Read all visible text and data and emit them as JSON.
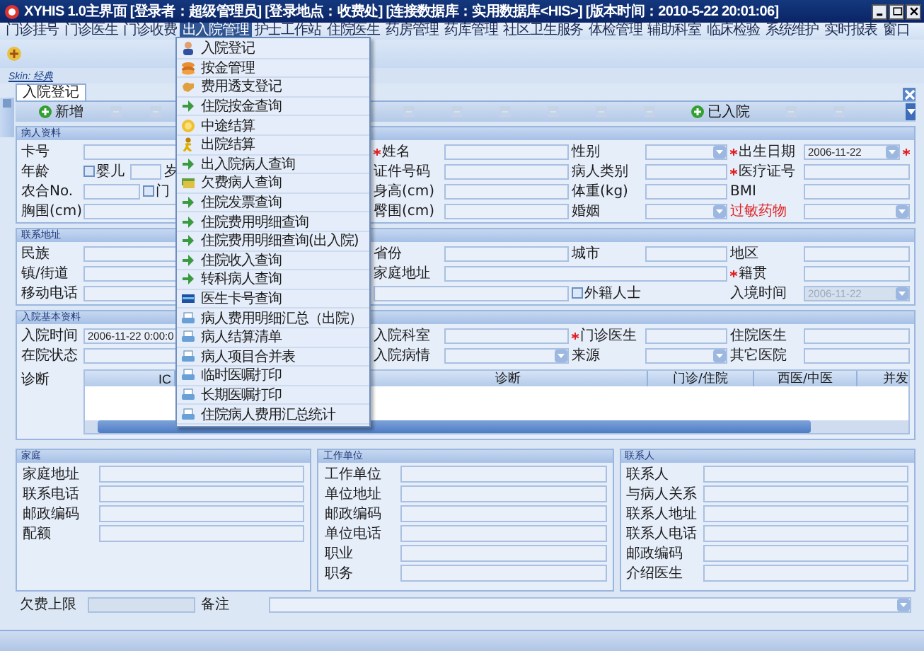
{
  "window": {
    "title": "XYHIS 1.0主界面 [登录者：超级管理员] [登录地点：收费处] [连接数据库：实用数据库<HIS>] [版本时间：2010-5-22 20:01:06]"
  },
  "menu_bar": [
    {
      "label": "门诊挂号",
      "selected": false
    },
    {
      "label": "门诊医生",
      "selected": false
    },
    {
      "label": "门诊收费",
      "selected": false
    },
    {
      "label": "出入院管理",
      "selected": true
    },
    {
      "label": "护士工作站",
      "selected": false
    },
    {
      "label": "住院医生",
      "selected": false
    },
    {
      "label": "药房管理",
      "selected": false
    },
    {
      "label": "药库管理",
      "selected": false
    },
    {
      "label": "社区卫生服务",
      "selected": false
    },
    {
      "label": "体检管理",
      "selected": false
    },
    {
      "label": "辅助科室",
      "selected": false
    },
    {
      "label": "临床检验",
      "selected": false
    },
    {
      "label": "系统维护",
      "selected": false
    },
    {
      "label": "实时报表",
      "selected": false
    },
    {
      "label": "窗口",
      "selected": false
    }
  ],
  "skin_link": "Skin: 经典",
  "tabs": [
    {
      "label": "入院登记",
      "selected": true
    }
  ],
  "toolbar": {
    "left": [
      {
        "kind": "button",
        "label": "新增",
        "disabled": false
      },
      {
        "kind": "icon",
        "disabled": true
      },
      {
        "kind": "icon",
        "disabled": true
      }
    ],
    "right": [
      {
        "kind": "icon",
        "disabled": true
      },
      {
        "kind": "icon",
        "disabled": true
      },
      {
        "kind": "icon",
        "disabled": true
      },
      {
        "kind": "icon",
        "disabled": true
      },
      {
        "kind": "icon",
        "disabled": true
      },
      {
        "kind": "icon",
        "disabled": true
      },
      {
        "kind": "button",
        "label": "已入院",
        "disabled": false
      },
      {
        "kind": "icon",
        "disabled": true
      },
      {
        "kind": "icon",
        "disabled": true
      }
    ]
  },
  "dropdown_menu": [
    {
      "label": "入院登记"
    },
    {
      "label": "按金管理"
    },
    {
      "label": "费用透支登记"
    },
    {
      "label": "住院按金查询"
    },
    {
      "label": "中途结算"
    },
    {
      "label": "出院结算"
    },
    {
      "label": "出入院病人查询"
    },
    {
      "label": "欠费病人查询"
    },
    {
      "label": "住院发票查询"
    },
    {
      "label": "住院费用明细查询"
    },
    {
      "label": "住院费用明细查询(出入院)"
    },
    {
      "label": "住院收入查询"
    },
    {
      "label": "转科病人查询"
    },
    {
      "label": "医生卡号查询"
    },
    {
      "label": "病人费用明细汇总（出院）"
    },
    {
      "label": "病人结算清单"
    },
    {
      "label": "病人项目合并表"
    },
    {
      "label": "临时医嘱打印"
    },
    {
      "label": "长期医嘱打印"
    },
    {
      "label": "住院病人费用汇总统计"
    }
  ],
  "sections": [
    {
      "title": "病人资料",
      "rows": [
        [
          {
            "kind": "label",
            "text": "卡号"
          },
          {
            "kind": "field"
          },
          {
            "kind": "label",
            "text": "姓名",
            "required": true
          },
          {
            "kind": "field"
          },
          {
            "kind": "label",
            "text": "性别"
          },
          {
            "kind": "combo"
          },
          {
            "kind": "label",
            "text": "出生日期",
            "required": true
          },
          {
            "kind": "combo",
            "value": "2006-11-22",
            "required": true
          }
        ],
        [
          {
            "kind": "label",
            "text": "年龄"
          },
          {
            "kind": "group",
            "items": [
              {
                "kind": "check",
                "text": "婴儿",
                "checked": false
              },
              {
                "kind": "field"
              },
              {
                "kind": "label",
                "text": "岁"
              }
            ]
          },
          {
            "kind": "label",
            "text": "证件号码"
          },
          {
            "kind": "field"
          },
          {
            "kind": "label",
            "text": "病人类别"
          },
          {
            "kind": "field"
          },
          {
            "kind": "label",
            "text": "医疗证号",
            "required": true
          },
          {
            "kind": "field"
          }
        ],
        [
          {
            "kind": "label",
            "text": "农合No."
          },
          {
            "kind": "group",
            "items": [
              {
                "kind": "field"
              },
              {
                "kind": "check",
                "text": "门",
                "checked": false
              }
            ]
          },
          {
            "kind": "label",
            "text": "身高(cm)"
          },
          {
            "kind": "field"
          },
          {
            "kind": "label",
            "text": "体重(kg)"
          },
          {
            "kind": "field"
          },
          {
            "kind": "label",
            "text": "BMI"
          },
          {
            "kind": "field"
          }
        ],
        [
          {
            "kind": "label",
            "text": "胸围(cm)"
          },
          {
            "kind": "field"
          },
          {
            "kind": "label",
            "text": "臀围(cm)"
          },
          {
            "kind": "field"
          },
          {
            "kind": "label",
            "text": "婚姻"
          },
          {
            "kind": "combo"
          },
          {
            "kind": "label",
            "text": "过敏药物",
            "alert": true
          },
          {
            "kind": "combo"
          }
        ]
      ]
    },
    {
      "title": "联系地址",
      "rows": [
        [
          {
            "kind": "label",
            "text": "民族"
          },
          {
            "kind": "field"
          },
          {
            "kind": "label",
            "text": "省份"
          },
          {
            "kind": "field"
          },
          {
            "kind": "label",
            "text": "城市"
          },
          {
            "kind": "field"
          },
          {
            "kind": "label",
            "text": "地区"
          },
          {
            "kind": "field"
          }
        ],
        [
          {
            "kind": "label",
            "text": "镇/街道"
          },
          {
            "kind": "field"
          },
          {
            "kind": "label",
            "text": "家庭地址"
          },
          {
            "kind": "longfield"
          },
          "",
          "",
          {
            "kind": "label",
            "text": "籍贯",
            "required": true
          },
          {
            "kind": "field"
          }
        ],
        [
          {
            "kind": "label",
            "text": "移动电话"
          },
          {
            "kind": "field"
          },
          {
            "kind": "widefield"
          },
          "",
          {
            "kind": "check",
            "text": "外籍人士",
            "checked": false
          },
          "",
          {
            "kind": "label",
            "text": "入境时间"
          },
          {
            "kind": "combo",
            "value": "2006-11-22",
            "disabled": true
          }
        ]
      ]
    },
    {
      "title": "入院基本资料",
      "rows": [
        [
          {
            "kind": "label",
            "text": "入院时间"
          },
          {
            "kind": "field",
            "value": "2006-11-22 0:00:0"
          },
          {
            "kind": "label",
            "text": "入院科室"
          },
          {
            "kind": "field"
          },
          {
            "kind": "label",
            "text": "门诊医生",
            "required": true
          },
          {
            "kind": "field"
          },
          {
            "kind": "label",
            "text": "住院医生"
          },
          {
            "kind": "field"
          }
        ],
        [
          {
            "kind": "label",
            "text": "在院状态"
          },
          {
            "kind": "field"
          },
          {
            "kind": "label",
            "text": "入院病情"
          },
          {
            "kind": "combo"
          },
          {
            "kind": "label",
            "text": "来源"
          },
          {
            "kind": "combo"
          },
          {
            "kind": "label",
            "text": "其它医院"
          },
          {
            "kind": "field"
          }
        ]
      ],
      "diagnosis": {
        "label": "诊断",
        "columns": [
          "IC",
          "",
          "诊断",
          "门诊/住院",
          "西医/中医",
          "并发"
        ]
      }
    }
  ],
  "groups": [
    {
      "title": "家庭",
      "fields": [
        "家庭地址",
        "联系电话",
        "邮政编码",
        "配额"
      ]
    },
    {
      "title": "工作单位",
      "fields": [
        "工作单位",
        "单位地址",
        "邮政编码",
        "单位电话",
        "职业",
        "职务"
      ]
    },
    {
      "title": "联系人",
      "fields": [
        "联系人",
        "与病人关系",
        "联系人地址",
        "联系人电话",
        "邮政编码",
        "介绍医生"
      ]
    }
  ],
  "footer": {
    "limit_label": "欠费上限",
    "note_label": "备注"
  }
}
